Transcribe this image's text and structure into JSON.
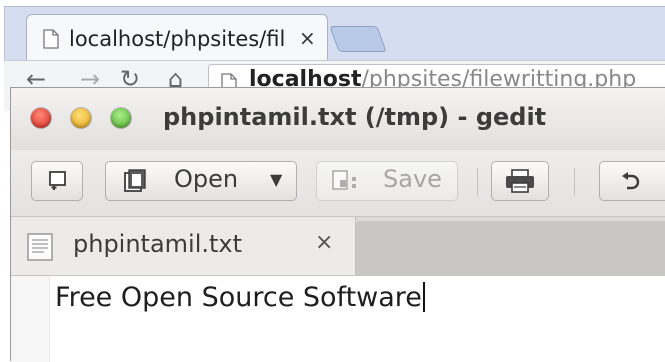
{
  "browser": {
    "tab_title": "localhost/phpsites/fil",
    "tab_close": "×",
    "nav_back": "←",
    "nav_forward": "→",
    "nav_reload": "↻",
    "nav_home": "⌂",
    "url_host": "localhost",
    "url_path": "/phpsites/filewritting.php"
  },
  "window": {
    "title": "phpintamil.txt (/tmp) - gedit"
  },
  "toolbar": {
    "new_icon": "new-document-icon",
    "open_label": "Open",
    "open_arrow": "▼",
    "save_label": "Save",
    "print_icon": "printer-icon",
    "undo_icon": "undo-icon"
  },
  "tabs": [
    {
      "label": "phpintamil.txt",
      "close": "×"
    }
  ],
  "editor": {
    "text": "Free Open Source Software"
  },
  "colors": {
    "close": "#d8241c",
    "minimize": "#e0a112",
    "maximize": "#4faa2a",
    "browser_frame": "#d4def0"
  }
}
